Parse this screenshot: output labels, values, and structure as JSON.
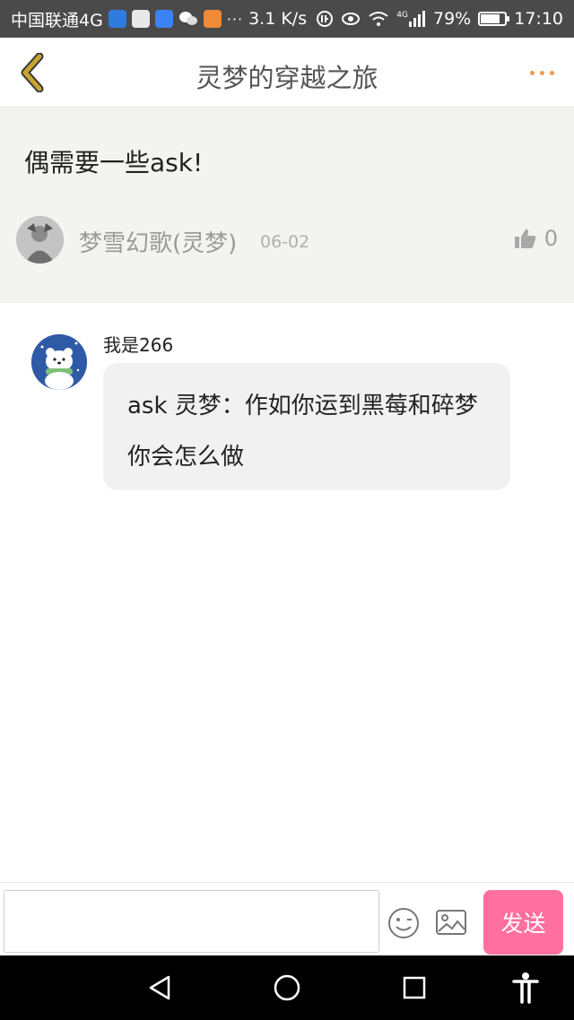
{
  "status_bar": {
    "carrier": "中国联通4G",
    "speed": "3.1 K/s",
    "signal_label": "4G",
    "battery_level_percent": 79,
    "battery_text": "79%",
    "time": "17:10",
    "app_icons": [
      "shield-app-icon",
      "photo-app-icon",
      "baidu-paw-icon",
      "wechat-icon",
      "video-app-icon"
    ],
    "more_indicator": "···"
  },
  "header": {
    "title": "灵梦的穿越之旅",
    "back_icon": "chevron-left-icon",
    "more_icon": "more-dots-icon",
    "accent_color": "#f39a4a",
    "back_color": "#c6a531"
  },
  "post": {
    "text": "偶需要一些ask!",
    "author": "梦雪幻歌(灵梦)",
    "date": "06-02",
    "like_count": "0",
    "like_icon": "thumbs-up-icon",
    "background": "#f3f3ef"
  },
  "comment": {
    "author": "我是266",
    "text": "ask 灵梦：作如你运到黑莓和碎梦你会怎么做"
  },
  "input_bar": {
    "input_value": "",
    "input_placeholder": "",
    "emoji_icon": "smiley-icon",
    "image_icon": "image-icon",
    "send_label": "发送",
    "send_color": "#ff6f9f"
  },
  "nav_bar": {
    "icons": [
      "back-triangle-icon",
      "home-circle-icon",
      "recents-square-icon",
      "accessibility-icon"
    ]
  }
}
